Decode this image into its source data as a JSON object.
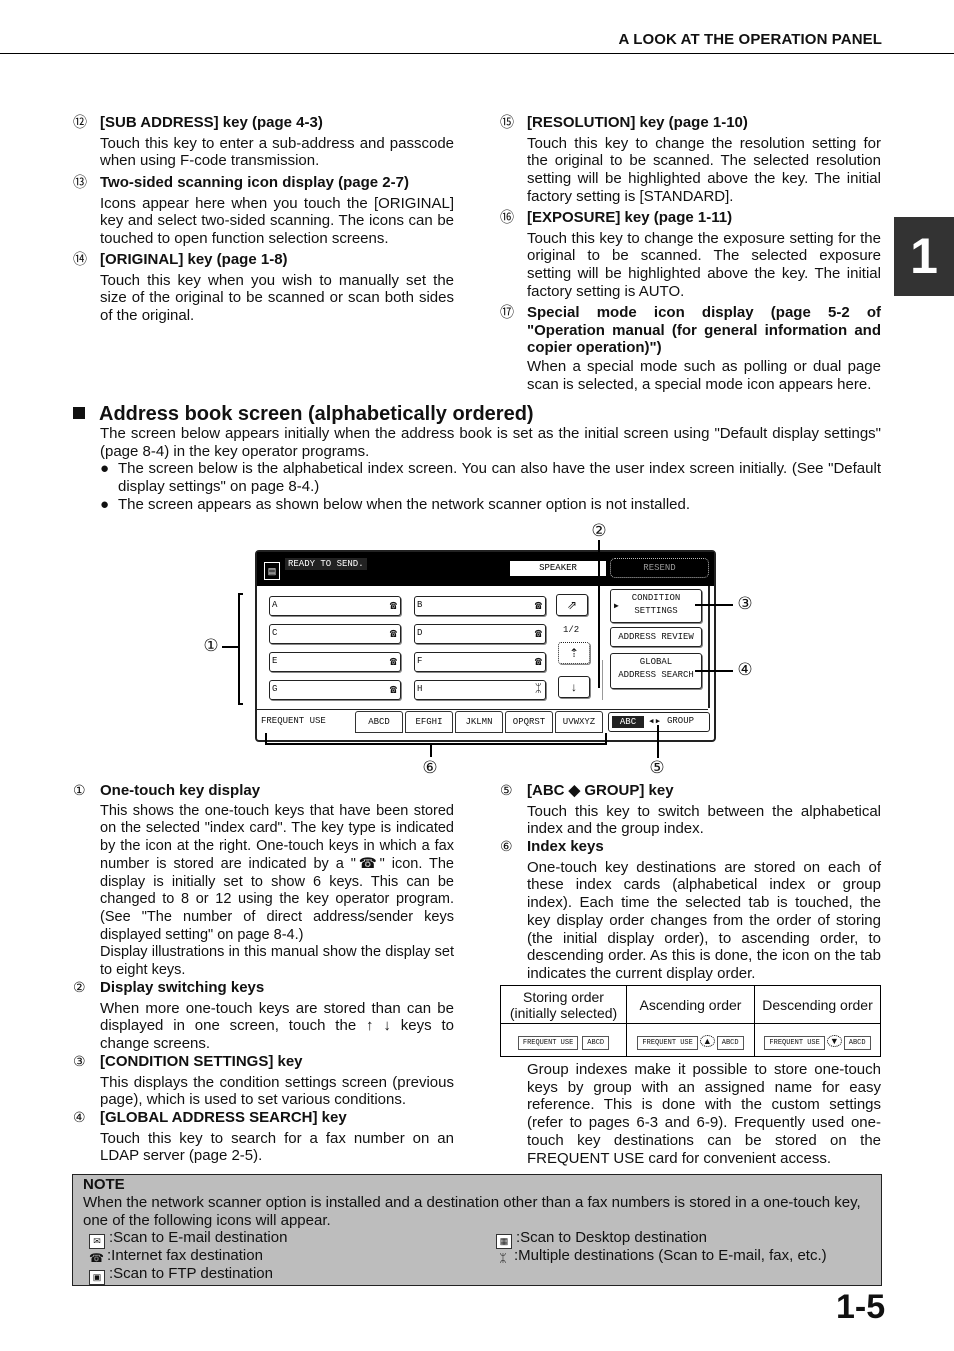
{
  "header": {
    "title": "A LOOK AT THE OPERATION PANEL",
    "chapter": "1"
  },
  "left_items": [
    {
      "num": "⑫",
      "head": "[SUB ADDRESS] key (page 4-3)",
      "body": "Touch this key to enter a sub-address and passcode when using F-code transmission."
    },
    {
      "num": "⑬",
      "head": "Two-sided scanning icon display (page 2-7)",
      "body": "Icons appear here when you touch the [ORIGINAL] key and select two-sided scanning. The icons can be touched to open function selection screens."
    },
    {
      "num": "⑭",
      "head": "[ORIGINAL] key (page 1-8)",
      "body": "Touch this key when you wish to manually set the size of the original to be scanned or scan both sides of the original."
    }
  ],
  "right_items": [
    {
      "num": "⑮",
      "head": "[RESOLUTION] key (page 1-10)",
      "body": "Touch this key to change the resolution setting for the original to be scanned. The selected resolution setting will be highlighted above the key. The initial factory setting is [STANDARD]."
    },
    {
      "num": "⑯",
      "head": "[EXPOSURE] key (page 1-11)",
      "body": "Touch this key to change the exposure setting for the original to be scanned. The selected exposure setting will be highlighted above the key. The initial factory setting is AUTO."
    },
    {
      "num": "⑰",
      "head": "Special mode icon display (page 5-2 of \"Operation manual (for general information and copier operation)\")",
      "body": "When a special mode such as polling or dual page scan is selected, a special mode icon appears here."
    }
  ],
  "section": {
    "title": "Address book screen (alphabetically ordered)",
    "intro": "The screen below appears initially when the address book is set as the initial screen using \"Default display settings\" (page 8-4) in the key operator programs.",
    "bullets": [
      "The screen below is the alphabetical index screen. You can also have the user index screen initially. (See \"Default display settings\" on page 8-4.)",
      "The screen appears as shown below when the network scanner option is not installed."
    ],
    "bullet_glyph": "●"
  },
  "panel": {
    "status": "READY TO SEND.",
    "speaker": "SPEAKER",
    "resend": "RESEND",
    "keys": [
      {
        "label": "A",
        "icon": "fax"
      },
      {
        "label": "B",
        "icon": "fax"
      },
      {
        "label": "C",
        "icon": "fax"
      },
      {
        "label": "D",
        "icon": "fax"
      },
      {
        "label": "E",
        "icon": "fax"
      },
      {
        "label": "F",
        "icon": "fax"
      },
      {
        "label": "G",
        "icon": "fax"
      },
      {
        "label": "H",
        "icon": "group"
      }
    ],
    "page_indicator": "1/2",
    "condition_settings": [
      "CONDITION",
      "SETTINGS"
    ],
    "address_review": "ADDRESS REVIEW",
    "global_search": [
      "GLOBAL",
      "ADDRESS SEARCH"
    ],
    "tabs": [
      "FREQUENT USE",
      "ABCD",
      "EFGHI",
      "JKLMN",
      "OPQRST",
      "UVWXYZ"
    ],
    "abc": "ABC",
    "group": "GROUP",
    "callouts": [
      "①",
      "②",
      "③",
      "④",
      "⑤",
      "⑥"
    ]
  },
  "lower_left": [
    {
      "num": "①",
      "head": "One-touch key display",
      "body": "This shows the one-touch keys that have been stored on the selected \"index card\". The key type is indicated by the icon at the right. One-touch keys in which a fax number is stored are indicated by a \"☎\" icon. The display is initially set to show 6 keys. This can be changed to 8 or 12 using the key operator program. (See \"The number of direct address/sender keys displayed setting\" on page 8-4.)",
      "extra": "Display illustrations in this manual show the display set to eight keys."
    },
    {
      "num": "②",
      "head": "Display switching keys",
      "body": "When more one-touch keys are stored than can be displayed in one screen, touch the ↑ ↓ keys to change screens."
    },
    {
      "num": "③",
      "head": "[CONDITION SETTINGS] key",
      "body": "This displays the condition settings screen (previous page), which is used to set various conditions."
    },
    {
      "num": "④",
      "head": "[GLOBAL ADDRESS SEARCH] key",
      "body": "Touch this key to search for a fax number on an LDAP server (page 2-5)."
    }
  ],
  "lower_right": [
    {
      "num": "⑤",
      "head": "[ABC ◆ GROUP] key",
      "body": "Touch this key to switch between the alphabetical index and the group index."
    },
    {
      "num": "⑥",
      "head": "Index keys",
      "body": "One-touch key destinations are stored on each of these index cards (alphabetical index or group index). Each time the selected tab is touched, the key display order changes from the order of storing (the initial display order), to ascending order, to descending order. As this is done, the icon on the tab indicates the current display order."
    }
  ],
  "order_table": {
    "headers": [
      "Storing order (initially selected)",
      "Ascending order",
      "Descending order"
    ],
    "tab_a": "FREQUENT USE",
    "tab_b": "ABCD",
    "icons": [
      "",
      "▲",
      "▼"
    ]
  },
  "group_text": "Group indexes make it possible to store one-touch keys by group with an assigned name for easy reference. This is done with the custom settings (refer to pages 6-3 and 6-9). Frequently used one-touch key destinations can be stored on the FREQUENT USE card for convenient access.",
  "note": {
    "head": "NOTE",
    "body": "When the network scanner option is installed and a destination other than a fax numbers is stored in a one-touch key, one of the following icons will appear.",
    "icons": [
      {
        "glyph": "✉",
        "label": ":Scan to E-mail destination"
      },
      {
        "glyph": "☎",
        "label": ":Internet fax destination"
      },
      {
        "glyph": "▣",
        "label": ":Scan to FTP destination"
      },
      {
        "glyph": "▦",
        "label": ":Scan to Desktop destination"
      },
      {
        "glyph": "ᛯ",
        "label": ":Multiple destinations (Scan to E-mail, fax, etc.)"
      }
    ]
  },
  "page_number": "1-5"
}
